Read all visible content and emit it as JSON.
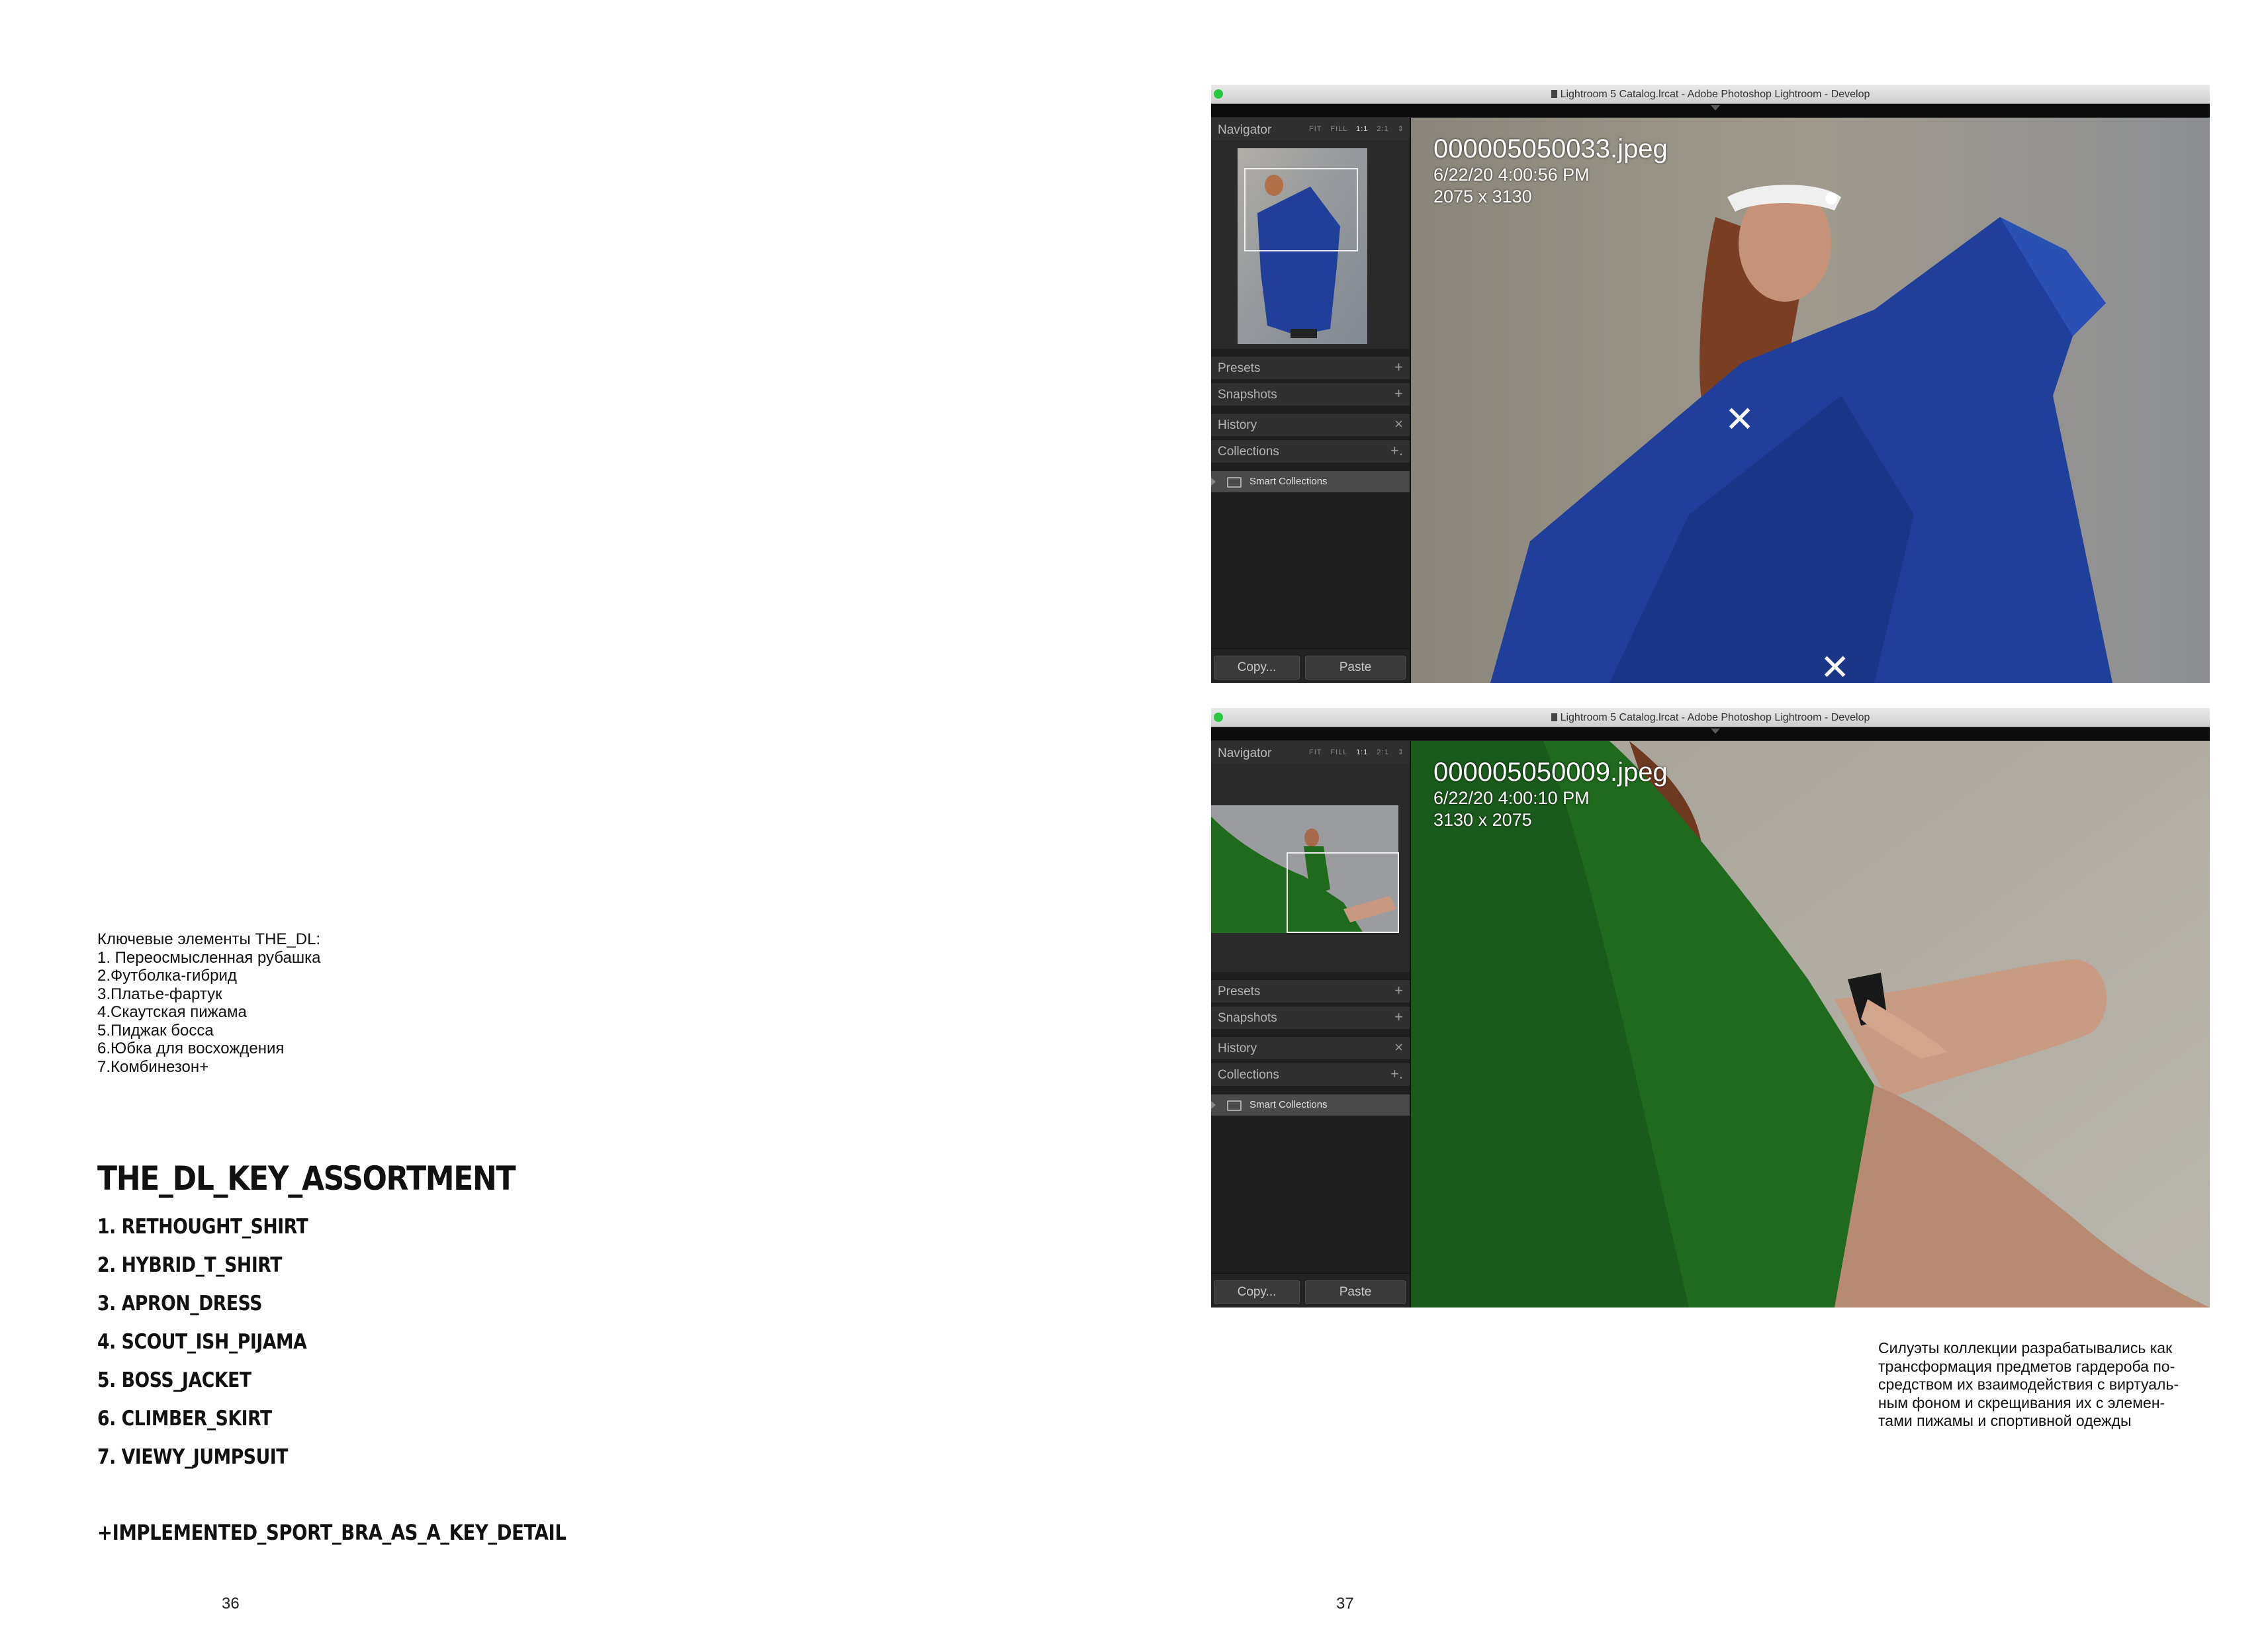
{
  "left_page": {
    "ru_title": "Ключевые элементы THE_DL:",
    "ru_items": [
      "1. Переосмысленная рубашка",
      "2.Футболка-гибрид",
      "3.Платье-фартук",
      "4.Скаутская пижама",
      "5.Пиджак босса",
      "6.Юбка для восхождения",
      "7.Комбинезон+"
    ],
    "assortment_title": "THE_DL_KEY_ASSORTMENT",
    "assortment_items": [
      "1. RETHOUGHT_SHIRT",
      "2. HYBRID_T_SHIRT",
      "3. APRON_DRESS",
      "4. SCOUT_ISH_PIJAMA",
      "5. BOSS_JACKET",
      "6. CLIMBER_SKIRT",
      "7. VIEWY_JUMPSUIT"
    ],
    "sport_note": "+IMPLEMENTED_SPORT_BRA_AS_A_KEY_DETAIL",
    "page_number": "36"
  },
  "right_page": {
    "page_number": "37",
    "caption_lines": [
      "Силуэты коллекции разрабатывались как",
      "трансформация предметов гардероба по-",
      "средством их взаимодействия с виртуаль-",
      "ным фоном и скрещивания их с элемен-",
      "тами пижамы и спортивной одежды"
    ]
  },
  "windows": [
    {
      "title": "Lightroom 5 Catalog.lrcat - Adobe Photoshop Lightroom - Develop",
      "navigator_label": "Navigator",
      "zoom_options": [
        "FIT",
        "FILL",
        "1:1",
        "2:1"
      ],
      "panels": [
        {
          "label": "Presets",
          "symbol": "+"
        },
        {
          "label": "Snapshots",
          "symbol": "+"
        },
        {
          "label": "History",
          "symbol": "×"
        },
        {
          "label": "Collections",
          "symbol": "+."
        }
      ],
      "smart_collections": "Smart Collections",
      "copy_label": "Copy...",
      "paste_label": "Paste",
      "filename": "000005050033.jpeg",
      "datetime": "6/22/20 4:00:56 PM",
      "dimensions": "2075 x 3130",
      "garment_color": "#1f3f9a"
    },
    {
      "title": "Lightroom 5 Catalog.lrcat - Adobe Photoshop Lightroom - Develop",
      "navigator_label": "Navigator",
      "zoom_options": [
        "FIT",
        "FILL",
        "1:1",
        "2:1"
      ],
      "panels": [
        {
          "label": "Presets",
          "symbol": "+"
        },
        {
          "label": "Snapshots",
          "symbol": "+"
        },
        {
          "label": "History",
          "symbol": "×"
        },
        {
          "label": "Collections",
          "symbol": "+."
        }
      ],
      "smart_collections": "Smart Collections",
      "copy_label": "Copy...",
      "paste_label": "Paste",
      "filename": "000005050009.jpeg",
      "datetime": "6/22/20 4:00:10 PM",
      "dimensions": "3130 x 2075",
      "garment_color": "#1f6a1c"
    }
  ]
}
